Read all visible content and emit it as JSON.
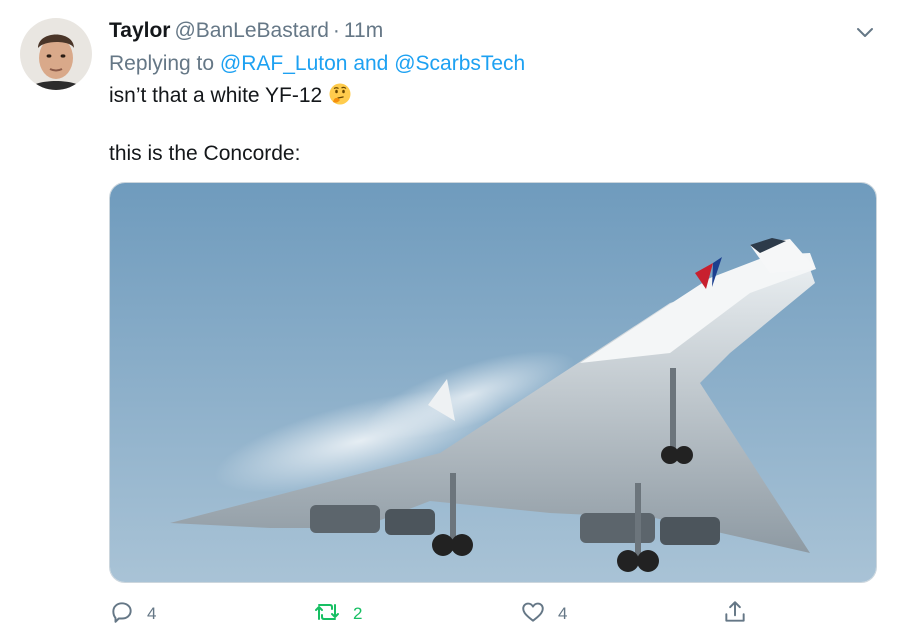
{
  "tweet": {
    "display_name": "Taylor",
    "handle": "@BanLeBastard",
    "separator": "·",
    "time": "11m",
    "replying_prefix": "Replying to",
    "mentions": [
      "@RAF_Luton",
      "@ScarbsTech"
    ],
    "mention_joiner": "and",
    "text_line_1": "isn’t that a white YF-12",
    "text_line_2": "this is the Concorde:",
    "emoji": "thinking-face-emoji"
  },
  "actions": {
    "reply_count": "4",
    "retweet_count": "2",
    "like_count": "4"
  },
  "icons": {
    "caret": "chevron-down-icon",
    "reply": "reply-icon",
    "retweet": "retweet-icon",
    "like": "heart-icon",
    "share": "share-icon"
  },
  "colors": {
    "link": "#1da1f2",
    "secondary_text": "#657786",
    "retweet_active": "#17bf63",
    "primary_text": "#14171a"
  }
}
